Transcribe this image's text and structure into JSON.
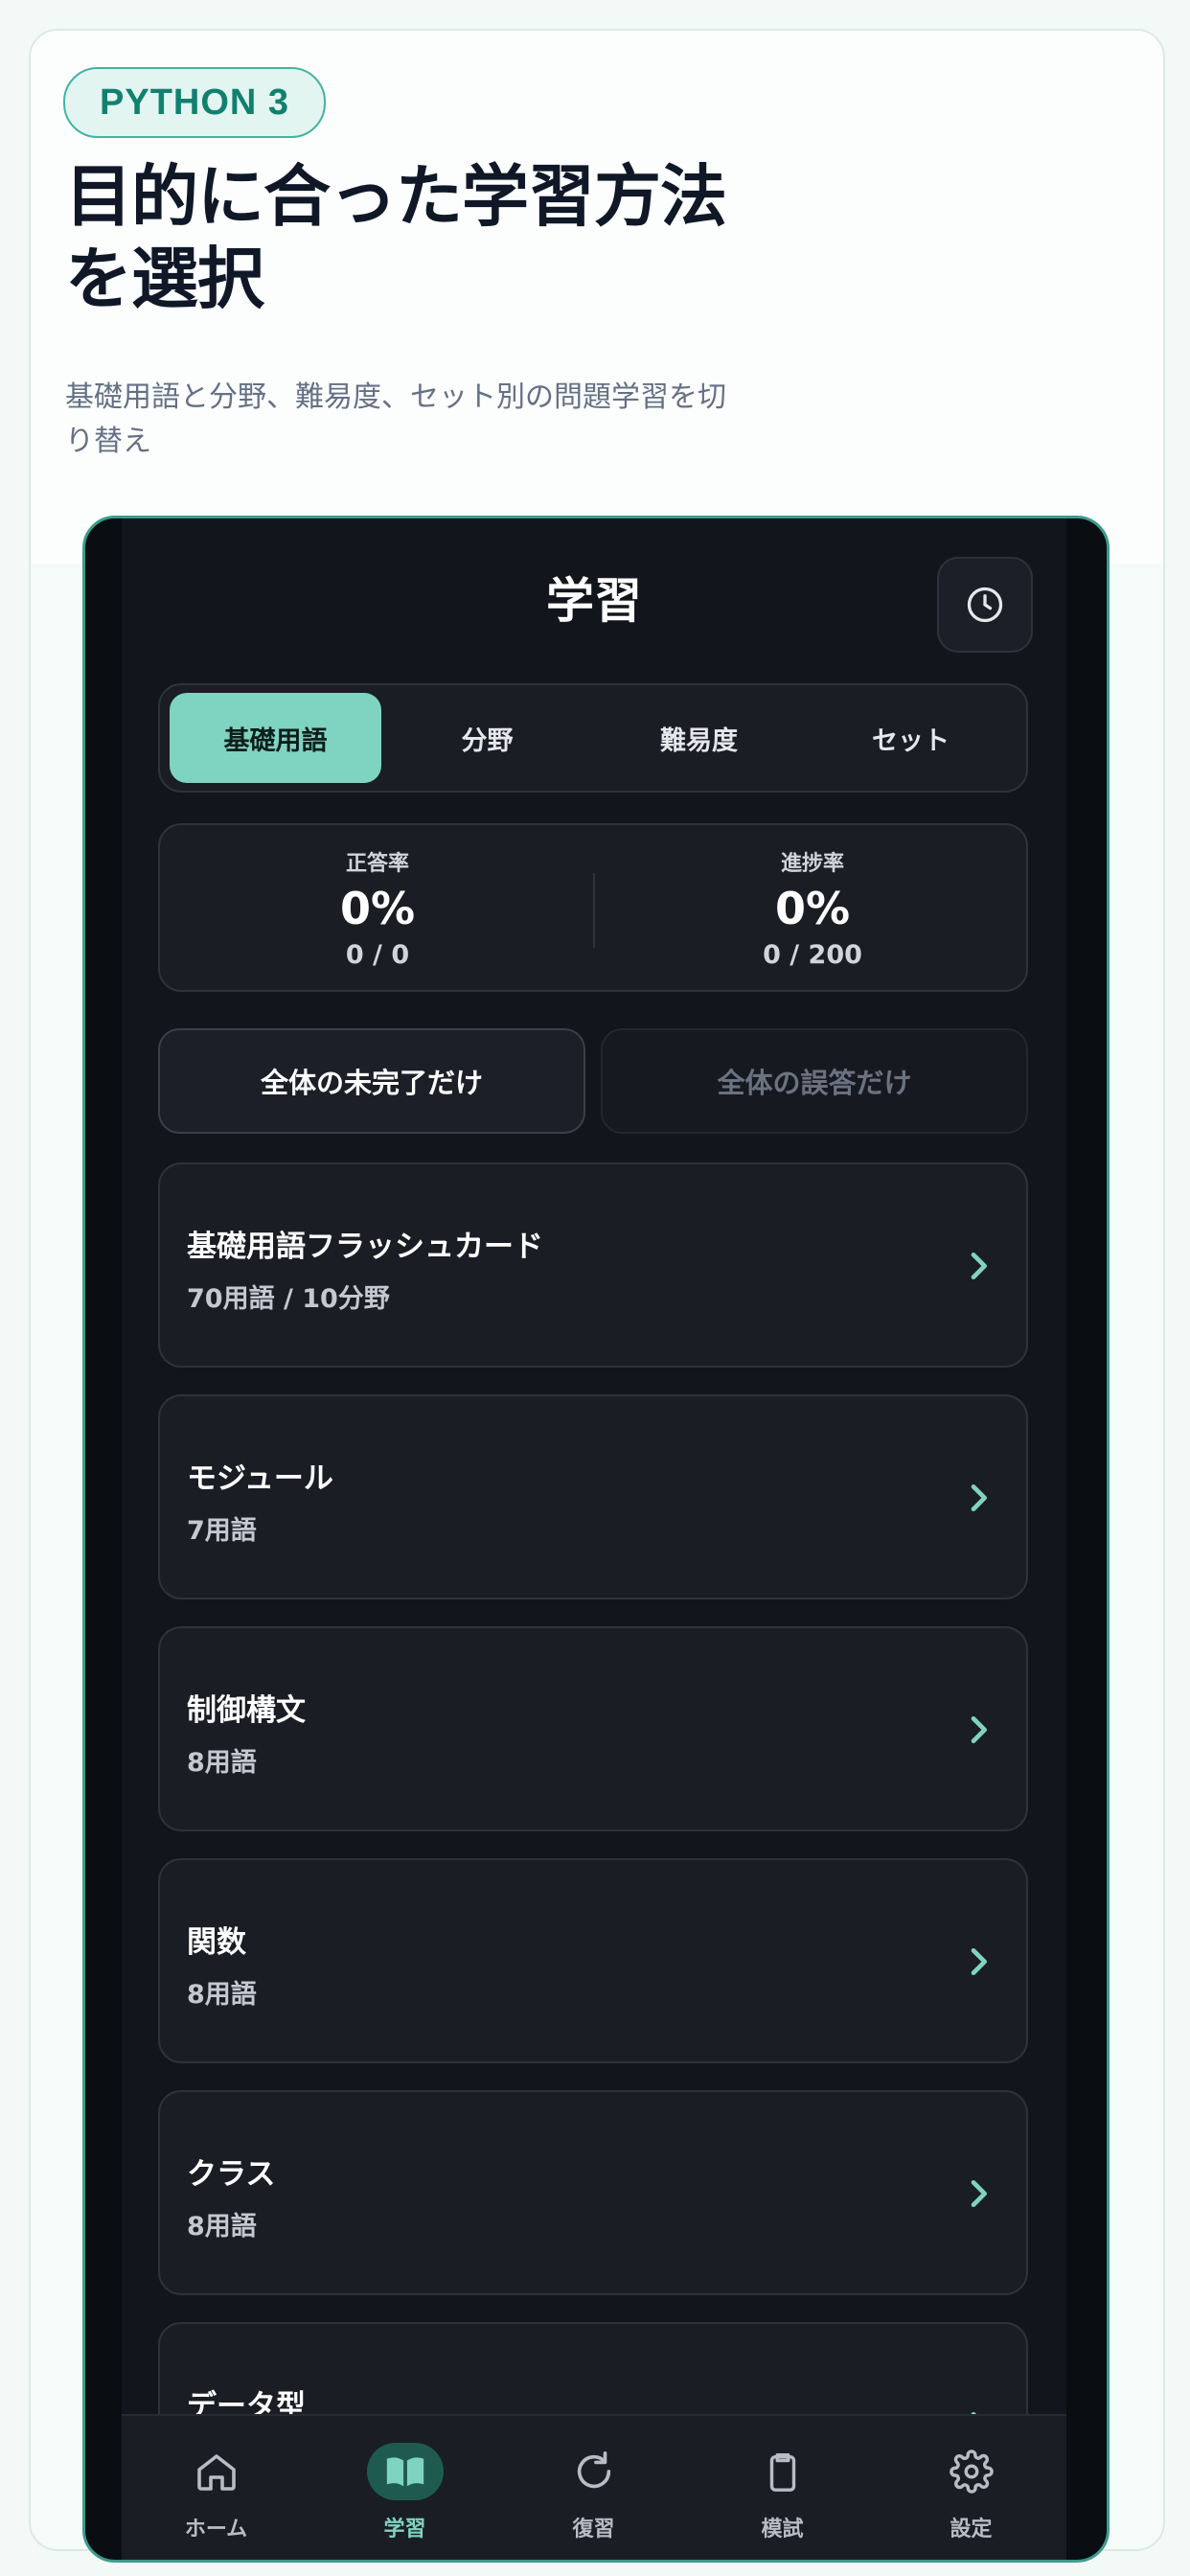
{
  "hero": {
    "badge": "PYTHON 3",
    "title": "目的に合った学習方法を選択",
    "subtitle": "基礎用語と分野、難易度、セット別の問題学習を切り替え"
  },
  "app": {
    "title": "学習",
    "history_icon": "clock-icon",
    "segments": [
      {
        "label": "基礎用語",
        "active": true
      },
      {
        "label": "分野",
        "active": false
      },
      {
        "label": "難易度",
        "active": false
      },
      {
        "label": "セット",
        "active": false
      }
    ],
    "stats": [
      {
        "label": "正答率",
        "value": "0%",
        "detail": "0 / 0"
      },
      {
        "label": "進捗率",
        "value": "0%",
        "detail": "0 / 200"
      }
    ],
    "filters": {
      "incomplete_label": "全体の未完了だけ",
      "wrong_label": "全体の誤答だけ"
    },
    "items": [
      {
        "title": "基礎用語フラッシュカード",
        "subtitle": "70用語 / 10分野"
      },
      {
        "title": "モジュール",
        "subtitle": "7用語"
      },
      {
        "title": "制御構文",
        "subtitle": "8用語"
      },
      {
        "title": "関数",
        "subtitle": "8用語"
      },
      {
        "title": "クラス",
        "subtitle": "8用語"
      },
      {
        "title": "データ型",
        "subtitle": ""
      }
    ],
    "tabs": [
      {
        "label": "ホーム",
        "icon": "home-icon",
        "active": false
      },
      {
        "label": "学習",
        "icon": "book-icon",
        "active": true
      },
      {
        "label": "復習",
        "icon": "refresh-icon",
        "active": false
      },
      {
        "label": "模試",
        "icon": "clipboard-icon",
        "active": false
      },
      {
        "label": "設定",
        "icon": "gear-icon",
        "active": false
      }
    ]
  },
  "colors": {
    "accent": "#7fd3c1",
    "badge_text": "#12806f",
    "screen_bg": "#12151b",
    "card_bg": "#1a1d24"
  }
}
